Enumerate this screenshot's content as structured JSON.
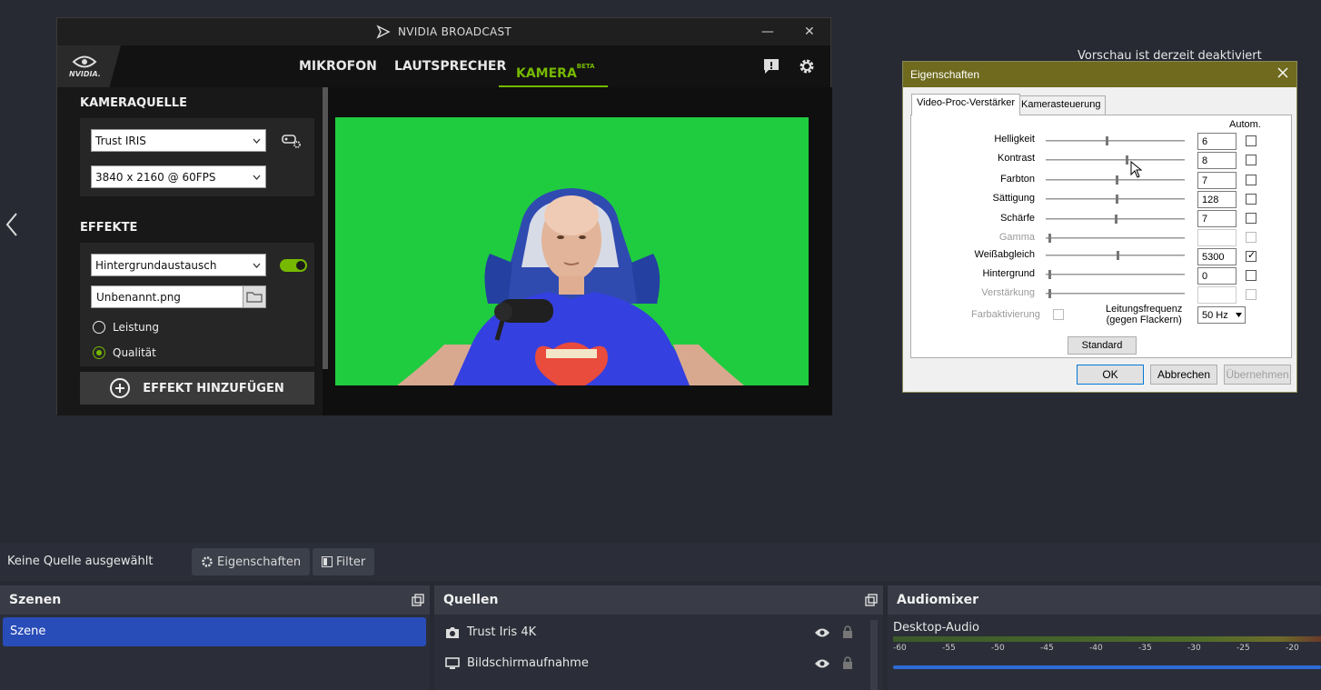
{
  "obs": {
    "preview_msg": "Vorschau ist derzeit deaktiviert",
    "status": "Keine Quelle ausgewählt",
    "btn_properties": "Eigenschaften",
    "btn_filter": "Filter",
    "scenes": {
      "title": "Szenen",
      "items": [
        "Szene"
      ]
    },
    "sources": {
      "title": "Quellen",
      "items": [
        {
          "label": "Trust Iris 4K",
          "icon": "camera-icon"
        },
        {
          "label": "Bildschirmaufnahme",
          "icon": "monitor-icon"
        }
      ]
    },
    "mixer": {
      "title": "Audiomixer",
      "channel": "Desktop-Audio",
      "ticks": [
        "-60",
        "-55",
        "-50",
        "-45",
        "-40",
        "-35",
        "-30",
        "-25",
        "-20"
      ]
    }
  },
  "nvidia": {
    "title": "NVIDIA BROADCAST",
    "logo_text": "NVIDIA.",
    "tabs": [
      "MIKROFON",
      "LAUTSPRECHER",
      "KAMERA"
    ],
    "beta": "BETA",
    "camera_source_heading": "KAMERAQUELLE",
    "camera": "Trust IRIS",
    "resolution": "3840 x 2160 @ 60FPS",
    "effects_heading": "EFFEKTE",
    "effect": "Hintergrundaustausch",
    "effect_enabled": true,
    "file": "Unbenannt.png",
    "radio_performance": "Leistung",
    "radio_quality": "Qualität",
    "selected_mode": "Qualität",
    "add_effect": "EFFEKT HINZUFÜGEN",
    "colors": {
      "accent": "#76b900",
      "greenscreen": "#1fcc3f"
    }
  },
  "dialog": {
    "title": "Eigenschaften",
    "tabs": [
      "Video-Proc-Verstärker",
      "Kamerasteuerung"
    ],
    "auto_header": "Autom.",
    "rows": [
      {
        "label": "Helligkeit",
        "value": "6",
        "auto": false,
        "disabled": false
      },
      {
        "label": "Kontrast",
        "value": "8",
        "auto": false,
        "disabled": false
      },
      {
        "label": "Farbton",
        "value": "7",
        "auto": false,
        "disabled": false
      },
      {
        "label": "Sättigung",
        "value": "128",
        "auto": false,
        "disabled": false
      },
      {
        "label": "Schärfe",
        "value": "7",
        "auto": false,
        "disabled": false
      },
      {
        "label": "Gamma",
        "value": "",
        "auto": false,
        "disabled": true
      },
      {
        "label": "Weißabgleich",
        "value": "5300",
        "auto": true,
        "disabled": false
      },
      {
        "label": "Hintergrund",
        "value": "0",
        "auto": false,
        "disabled": false
      },
      {
        "label": "Verstärkung",
        "value": "",
        "auto": false,
        "disabled": true
      }
    ],
    "color_enable": "Farbaktivierung",
    "powerline_label_1": "Leitungsfrequenz",
    "powerline_label_2": "(gegen Flackern)",
    "powerline_value": "50 Hz",
    "btn_default": "Standard",
    "btn_ok": "OK",
    "btn_cancel": "Abbrechen",
    "btn_apply": "Übernehmen"
  }
}
